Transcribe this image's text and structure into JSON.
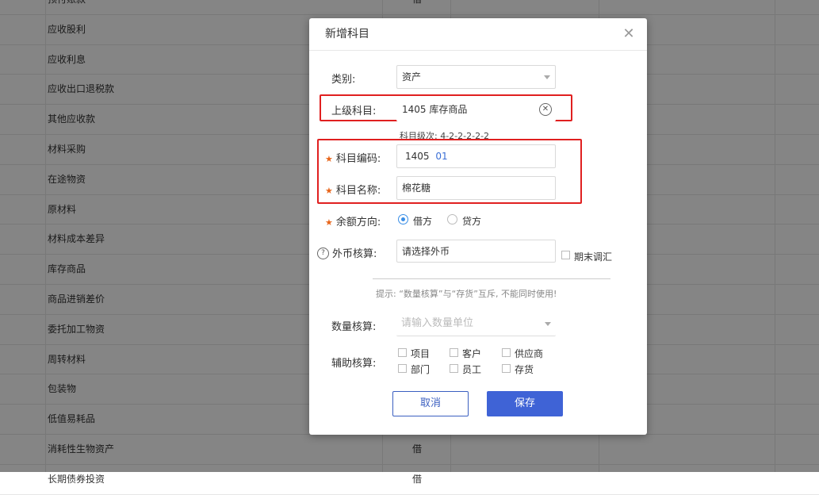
{
  "background": {
    "rows": [
      {
        "name": "预付账款",
        "dir": "借"
      },
      {
        "name": "应收股利",
        "dir": ""
      },
      {
        "name": "应收利息",
        "dir": ""
      },
      {
        "name": "应收出口退税款",
        "dir": ""
      },
      {
        "name": "其他应收款",
        "dir": ""
      },
      {
        "name": "材料采购",
        "dir": ""
      },
      {
        "name": "在途物资",
        "dir": ""
      },
      {
        "name": "原材料",
        "dir": ""
      },
      {
        "name": "材料成本差异",
        "dir": ""
      },
      {
        "name": "库存商品",
        "dir": ""
      },
      {
        "name": "商品进销差价",
        "dir": ""
      },
      {
        "name": "委托加工物资",
        "dir": ""
      },
      {
        "name": "周转材料",
        "dir": ""
      },
      {
        "name": "包装物",
        "dir": ""
      },
      {
        "name": "低值易耗品",
        "dir": ""
      },
      {
        "name": "消耗性生物资产",
        "dir": "借"
      },
      {
        "name": "长期债券投资",
        "dir": "借"
      }
    ]
  },
  "dialog": {
    "title": "新增科目",
    "close_icon": "close-icon",
    "category_label": "类别:",
    "category_value": "资产",
    "parent_label": "上级科目:",
    "parent_value": "1405 库存商品",
    "level_hint": "科目级次: 4-2-2-2-2-2",
    "code_label": "科目编码:",
    "code_prefix": "1405",
    "code_suffix": "01",
    "name_label": "科目名称:",
    "name_value": "棉花糖",
    "balance_label": "余额方向:",
    "balance_options": [
      "借方",
      "贷方"
    ],
    "balance_selected": "借方",
    "currency_label": "外币核算:",
    "currency_placeholder": "请选择外币",
    "period_end_label": "期末调汇",
    "hint_text": "提示: “数量核算”与“存货”互斥, 不能同时使用!",
    "quantity_label": "数量核算:",
    "quantity_placeholder": "请输入数量单位",
    "aux_label": "辅助核算:",
    "aux_options": [
      "项目",
      "客户",
      "供应商",
      "部门",
      "员工",
      "存货"
    ],
    "cancel_label": "取消",
    "save_label": "保存"
  },
  "colors": {
    "primary": "#3f63d6",
    "required_star": "#e8651a",
    "highlight_box": "#e02020",
    "radio_on": "#3a8ee6"
  }
}
